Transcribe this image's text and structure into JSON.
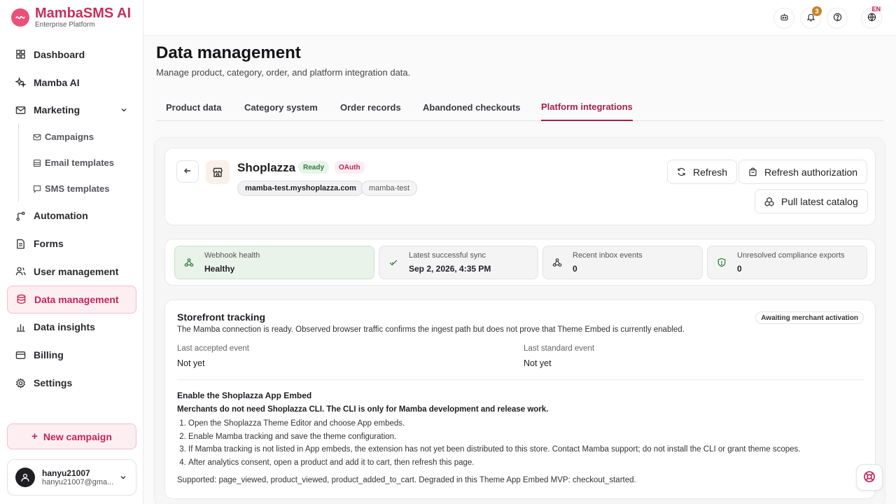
{
  "brand": {
    "name": "MambaSMS AI",
    "subtitle": "Enterprise Platform",
    "accent": "#c72f5d"
  },
  "sidebar": {
    "items": [
      {
        "label": "Dashboard",
        "icon": "grid-icon"
      },
      {
        "label": "Mamba AI",
        "icon": "sparkle-icon"
      },
      {
        "label": "Marketing",
        "icon": "mail-icon"
      },
      {
        "label": "Automation",
        "icon": "branch-icon"
      },
      {
        "label": "Forms",
        "icon": "document-icon"
      },
      {
        "label": "User management",
        "icon": "users-icon"
      },
      {
        "label": "Data management",
        "icon": "database-icon"
      },
      {
        "label": "Data insights",
        "icon": "chart-icon"
      },
      {
        "label": "Billing",
        "icon": "card-icon"
      },
      {
        "label": "Settings",
        "icon": "gear-icon"
      }
    ],
    "marketing_sub": [
      {
        "label": "Campaigns",
        "icon": "mail-icon"
      },
      {
        "label": "Email templates",
        "icon": "template-icon"
      },
      {
        "label": "SMS templates",
        "icon": "chat-icon"
      }
    ],
    "new_campaign": "New campaign",
    "user": {
      "name": "hanyu21007",
      "email": "hanyu21007@gma..."
    }
  },
  "topbar": {
    "notification_count": "3",
    "language": "EN"
  },
  "page": {
    "title": "Data management",
    "subtitle": "Manage product, category, order, and platform integration data.",
    "tabs": [
      "Product data",
      "Category system",
      "Order records",
      "Abandoned checkouts",
      "Platform integrations"
    ]
  },
  "integration": {
    "name": "Shoplazza",
    "status": "Ready",
    "auth": "OAuth",
    "domain": "mamba-test.myshoplazza.com",
    "store_id": "mamba-test",
    "buttons": {
      "refresh": "Refresh",
      "refresh_auth": "Refresh authorization",
      "pull_catalog": "Pull latest catalog"
    }
  },
  "stats": [
    {
      "label": "Webhook health",
      "value": "Healthy",
      "icon": "webhook-icon"
    },
    {
      "label": "Latest successful sync",
      "value": "Sep 2, 2026, 4:35 PM",
      "icon": "check-icon"
    },
    {
      "label": "Recent inbox events",
      "value": "0",
      "icon": "webhook-icon"
    },
    {
      "label": "Unresolved compliance exports",
      "value": "0",
      "icon": "shield-icon"
    }
  ],
  "tracking": {
    "title": "Storefront tracking",
    "status": "Awaiting merchant activation",
    "description": "The Mamba connection is ready. Observed browser traffic confirms the ingest path but does not prove that Theme Embed is currently enabled.",
    "last_accepted_label": "Last accepted event",
    "last_accepted_value": "Not yet",
    "last_standard_label": "Last standard event",
    "last_standard_value": "Not yet",
    "embed_title": "Enable the Shoplazza App Embed",
    "embed_note": "Merchants do not need Shoplazza CLI. The CLI is only for Mamba development and release work.",
    "steps": [
      "Open the Shoplazza Theme Editor and choose App embeds.",
      "Enable Mamba tracking and save the theme configuration.",
      "If Mamba tracking is not listed in App embeds, the extension has not yet been distributed to this store. Contact Mamba support; do not install the CLI or grant theme scopes.",
      "After analytics consent, open a product and add it to cart, then refresh this page."
    ],
    "supported": "Supported: page_viewed, product_viewed, product_added_to_cart. Degraded in this Theme App Embed MVP: checkout_started."
  }
}
